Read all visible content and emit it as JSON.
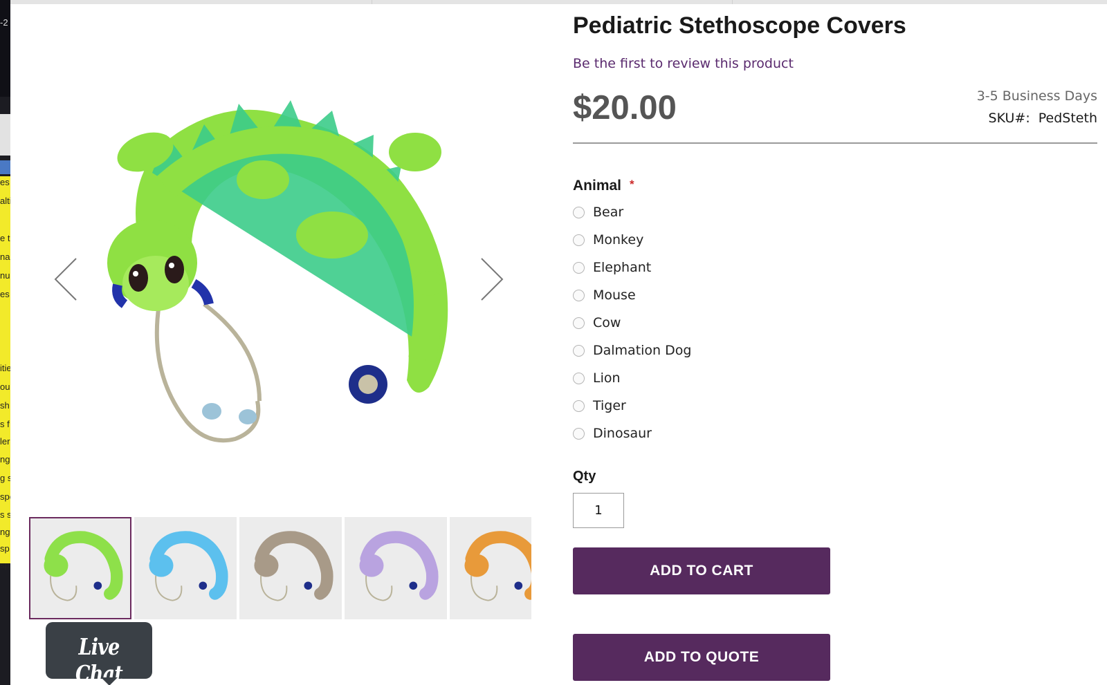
{
  "product": {
    "title": "Pediatric Stethoscope Covers",
    "review_link": "Be the first to review this product",
    "price": "$20.00",
    "shipping": "3-5 Business Days",
    "sku_label": "SKU#:",
    "sku_value": "PedSteth"
  },
  "options": {
    "label": "Animal",
    "required_mark": "*",
    "choices": [
      "Bear",
      "Monkey",
      "Elephant",
      "Mouse",
      "Cow",
      "Dalmation Dog",
      "Lion",
      "Tiger",
      "Dinosaur"
    ]
  },
  "qty": {
    "label": "Qty",
    "value": "1"
  },
  "buttons": {
    "add_to_cart": "ADD TO CART",
    "add_to_quote": "ADD TO QUOTE"
  },
  "gallery": {
    "thumbnails": [
      {
        "name": "dinosaur",
        "color": "#8ee04a"
      },
      {
        "name": "elephant",
        "color": "#5cc0ee"
      },
      {
        "name": "monkey",
        "color": "#a89a88"
      },
      {
        "name": "mouse",
        "color": "#b9a3e0"
      },
      {
        "name": "tiger",
        "color": "#e89a3a"
      }
    ]
  },
  "live_chat": {
    "label": "Live Chat"
  },
  "colors": {
    "brand_purple": "#562a5e",
    "review_link": "#5a2a6e",
    "required": "#cc2a2a",
    "live_chat_bg": "#3a4046"
  },
  "background_window": {
    "fragments": [
      "-2",
      "es",
      "alti",
      "e t",
      "na",
      "nu",
      "es",
      "itie",
      "oul",
      "sh",
      "s f",
      "ler",
      "ng",
      "g s",
      "spe",
      "s s",
      "ng",
      "sp",
      "sp"
    ]
  }
}
